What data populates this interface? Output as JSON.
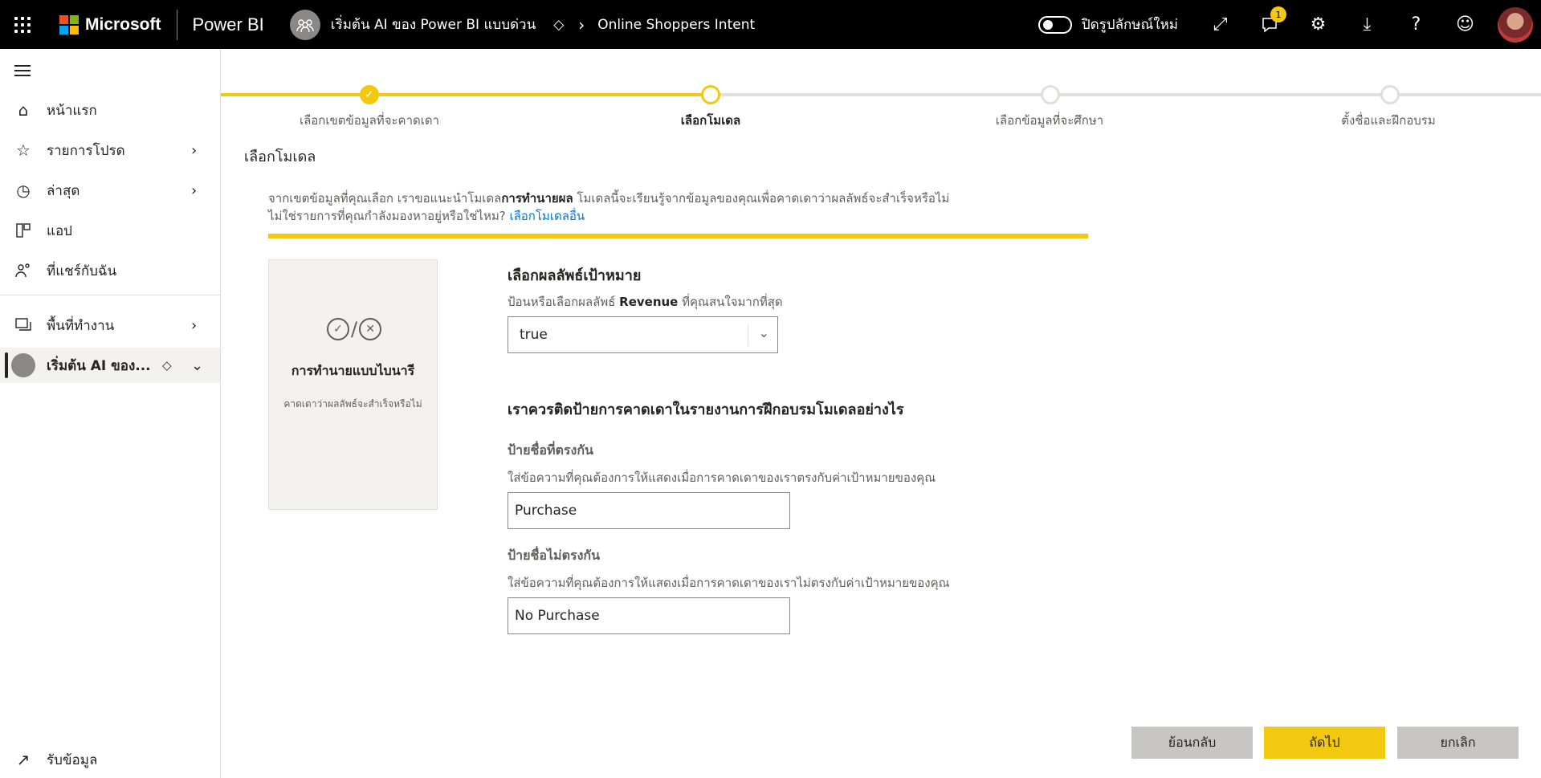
{
  "header": {
    "brand": "Microsoft",
    "product": "Power BI",
    "workspace": "เริ่มต้น AI ของ Power BI แบบด่วน",
    "breadcrumb_current": "Online Shoppers Intent",
    "toggle_label": "ปิดรูปลักษณ์ใหม่",
    "notification_count": "1"
  },
  "sidebar": {
    "items": [
      {
        "label": "หน้าแรก",
        "icon": "home-icon"
      },
      {
        "label": "รายการโปรด",
        "icon": "star-icon"
      },
      {
        "label": "ล่าสุด",
        "icon": "clock-icon"
      },
      {
        "label": "แอป",
        "icon": "apps-icon"
      },
      {
        "label": "ที่แชร์กับฉัน",
        "icon": "shared-icon"
      },
      {
        "label": "พื้นที่ทำงาน",
        "icon": "workspaces-icon"
      },
      {
        "label": "เริ่มต้น AI ของ...",
        "icon": "workspace-avatar-icon"
      }
    ],
    "get_data": "รับข้อมูล"
  },
  "stepper": {
    "steps": [
      {
        "label": "เลือกเขตข้อมูลที่จะคาดเดา",
        "state": "done"
      },
      {
        "label": "เลือกโมเดล",
        "state": "current"
      },
      {
        "label": "เลือกข้อมูลที่จะศึกษา",
        "state": "pending"
      },
      {
        "label": "ตั้งชื่อและฝึกอบรม",
        "state": "pending"
      }
    ],
    "accent": "#f2c811"
  },
  "main": {
    "title": "เลือกโมเดล",
    "intro_part1": "จากเขตข้อมูลที่คุณเลือก เราขอแนะนำโมเดล",
    "intro_bold": "การทำนายผล",
    "intro_part2": " โมเดลนี้จะเรียนรู้จากข้อมูลของคุณเพื่อคาดเดาว่าผลลัพธ์จะสำเร็จหรือไม่",
    "intro_line2": "ไม่ใช่รายการที่คุณกำลังมองหาอยู่หรือใช่ไหม? ",
    "intro_link": "เลือกโมเดลอื่น",
    "model_card": {
      "title": "การทำนายแบบไบนารี",
      "description": "คาดเดาว่าผลลัพธ์จะสำเร็จหรือไม่"
    },
    "target": {
      "heading": "เลือกผลลัพธ์เป้าหมาย",
      "helper_pre": "ป้อนหรือเลือกผลลัพธ์ ",
      "helper_field": "Revenue",
      "helper_post": " ที่คุณสนใจมากที่สุด",
      "selected": "true"
    },
    "labels": {
      "heading": "เราควรติดป้ายการคาดเดาในรายงานการฝึกอบรมโมเดลอย่างไร",
      "match_title": "ป้ายชื่อที่ตรงกัน",
      "match_helper": "ใส่ข้อความที่คุณต้องการให้แสดงเมื่อการคาดเดาของเราตรงกับค่าเป้าหมายของคุณ",
      "match_value": "Purchase",
      "nomatch_title": "ป้ายชื่อไม่ตรงกัน",
      "nomatch_helper": "ใส่ข้อความที่คุณต้องการให้แสดงเมื่อการคาดเดาของเราไม่ตรงกับค่าเป้าหมายของคุณ",
      "nomatch_value": "No Purchase"
    }
  },
  "buttons": {
    "back": "ย้อนกลับ",
    "next": "ถัดไป",
    "cancel": "ยกเลิก"
  }
}
